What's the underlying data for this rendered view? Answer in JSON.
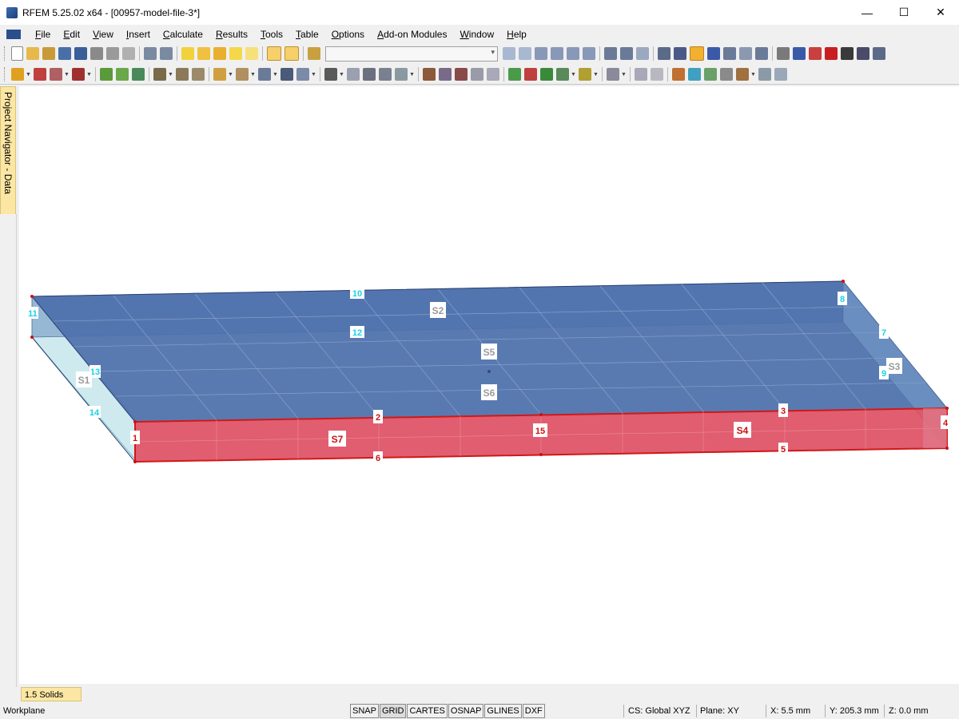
{
  "window": {
    "title": "RFEM 5.25.02 x64 - [00957-model-file-3*]",
    "minimize": "—",
    "maximize": "☐",
    "close": "✕"
  },
  "menu": [
    "File",
    "Edit",
    "View",
    "Insert",
    "Calculate",
    "Results",
    "Tools",
    "Table",
    "Options",
    "Add-on Modules",
    "Window",
    "Help"
  ],
  "sidebar": {
    "navigator_label": "Project Navigator - Data"
  },
  "bottom_tab": "1.5 Solids",
  "status": {
    "left": "Workplane",
    "modes": [
      "SNAP",
      "GRID",
      "CARTES",
      "OSNAP",
      "GLINES",
      "DXF"
    ],
    "cs": "CS: Global XYZ",
    "plane": "Plane: XY",
    "x": "X:  5.5 mm",
    "y": "Y:  205.3 mm",
    "z": "Z:  0.0 mm"
  },
  "model": {
    "node_labels": [
      "1",
      "2",
      "3",
      "4",
      "5",
      "6",
      "7",
      "8",
      "9",
      "10",
      "11",
      "12",
      "13",
      "14",
      "15"
    ],
    "surface_labels": [
      "S1",
      "S2",
      "S3",
      "S4",
      "S5",
      "S6",
      "S7"
    ],
    "colors": {
      "top": "#4a6fa8",
      "front": "#e05060",
      "edge": "#d01818",
      "node_cyan": "#19d2e6",
      "node_red": "#cc1010"
    }
  }
}
